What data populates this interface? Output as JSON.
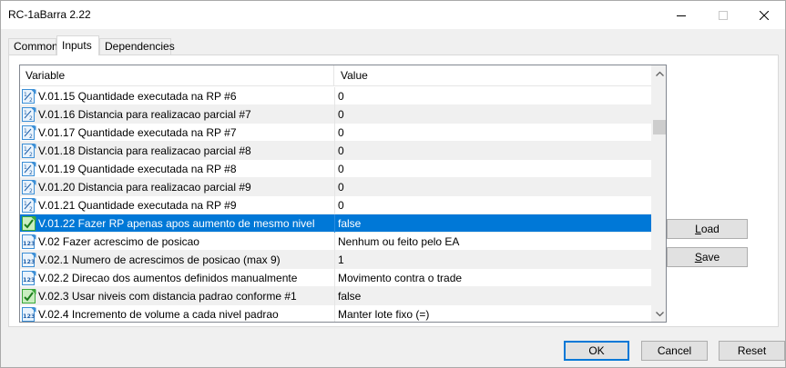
{
  "window": {
    "title": "RC-1aBarra 2.22"
  },
  "tabs": [
    {
      "label": "Common"
    },
    {
      "label": "Inputs"
    },
    {
      "label": "Dependencies"
    }
  ],
  "grid": {
    "columns": {
      "variable": "Variable",
      "value": "Value"
    },
    "rows": [
      {
        "icon": "fraction-icon",
        "variable": "V.01.15 Quantidade executada na RP #6",
        "value": "0"
      },
      {
        "icon": "fraction-icon",
        "variable": "V.01.16 Distancia para realizacao parcial #7",
        "value": "0"
      },
      {
        "icon": "fraction-icon",
        "variable": "V.01.17 Quantidade executada na RP #7",
        "value": "0"
      },
      {
        "icon": "fraction-icon",
        "variable": "V.01.18 Distancia para realizacao parcial #8",
        "value": "0"
      },
      {
        "icon": "fraction-icon",
        "variable": "V.01.19 Quantidade executada na RP #8",
        "value": "0"
      },
      {
        "icon": "fraction-icon",
        "variable": "V.01.20 Distancia para realizacao parcial #9",
        "value": "0"
      },
      {
        "icon": "fraction-icon",
        "variable": "V.01.21 Quantidade executada na RP #9",
        "value": "0"
      },
      {
        "icon": "boolean-icon",
        "variable": "V.01.22 Fazer RP apenas apos aumento de mesmo nivel",
        "value": "false"
      },
      {
        "icon": "integer-icon",
        "variable": "V.02 Fazer acrescimo de posicao",
        "value": "Nenhum ou feito pelo EA"
      },
      {
        "icon": "integer-icon",
        "variable": "V.02.1 Numero de acrescimos de posicao (max 9)",
        "value": "1"
      },
      {
        "icon": "integer-icon",
        "variable": "V.02.2 Direcao dos aumentos definidos manualmente",
        "value": "Movimento contra o trade"
      },
      {
        "icon": "boolean-icon",
        "variable": "V.02.3 Usar niveis com distancia padrao conforme #1",
        "value": "false"
      },
      {
        "icon": "integer-icon",
        "variable": "V.02.4 Incremento de volume a cada nivel padrao",
        "value": "Manter lote fixo (=)"
      }
    ]
  },
  "buttons": {
    "load": {
      "first": "L",
      "rest": "oad"
    },
    "save": {
      "first": "S",
      "rest": "ave"
    },
    "ok": "OK",
    "cancel": "Cancel",
    "reset": "Reset"
  },
  "colors": {
    "selection": "#0078d7",
    "icon_blue": "#3c8fd6",
    "icon_green": "#3aa83a"
  }
}
